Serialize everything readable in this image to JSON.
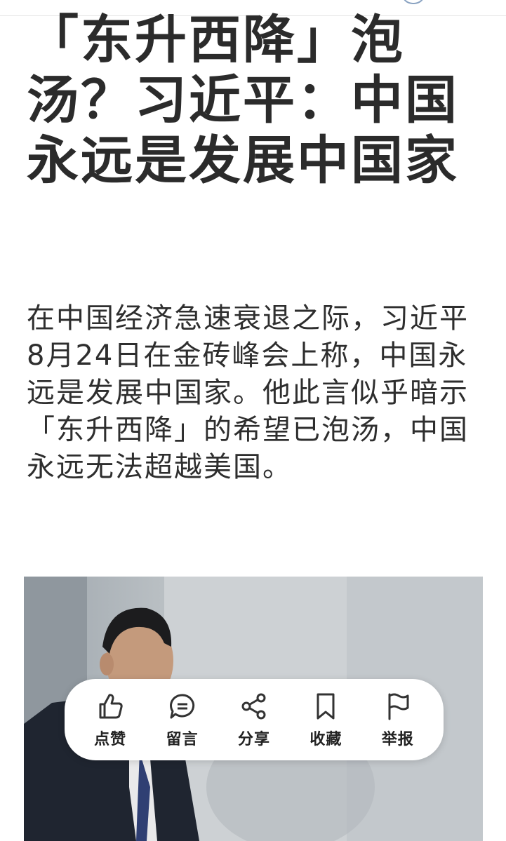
{
  "article": {
    "headline": "「东升西降」泡汤？习近平：中国永远是发展中国家",
    "summary": "在中国经济急速衰退之际，习近平8月24日在金砖峰会上称，中国永远是发展中国家。他此言似乎暗示「东升西降」的希望已泡汤，中国永远无法超越美国。"
  },
  "action_bar": {
    "items": [
      {
        "label": "点赞",
        "icon": "thumbs-up-icon"
      },
      {
        "label": "留言",
        "icon": "comment-icon"
      },
      {
        "label": "分享",
        "icon": "share-icon"
      },
      {
        "label": "收藏",
        "icon": "bookmark-icon"
      },
      {
        "label": "举报",
        "icon": "flag-icon"
      }
    ]
  },
  "colors": {
    "text": "#2b2b2b",
    "action_bar_bg": "#ffffff",
    "photo_background": "#b9bfc3"
  }
}
